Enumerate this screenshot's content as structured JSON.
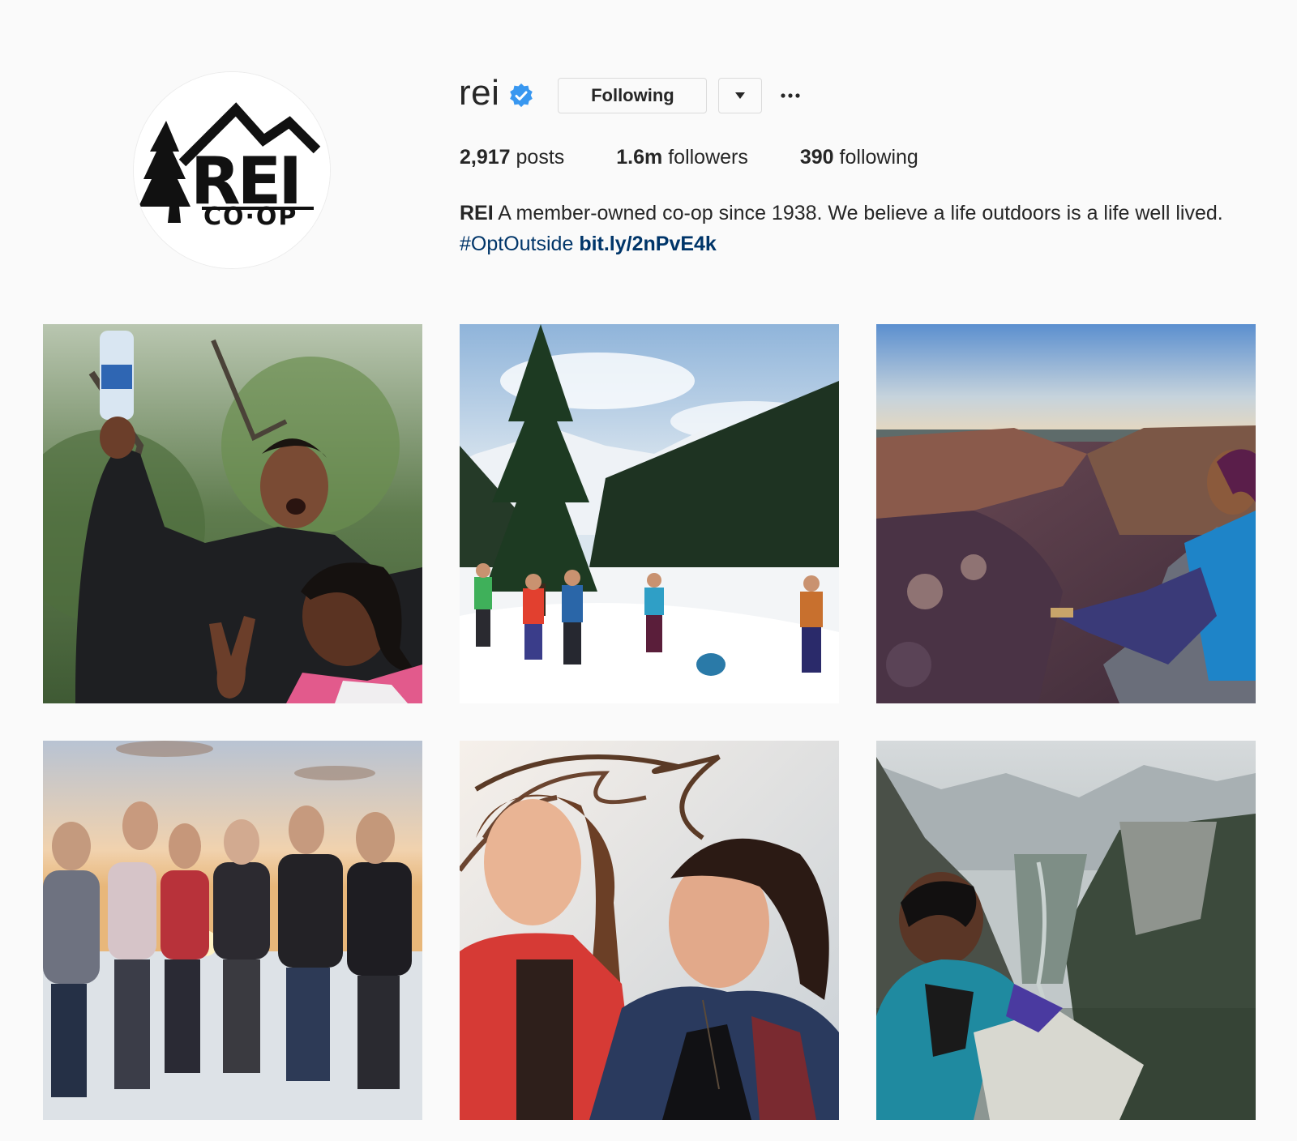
{
  "profile": {
    "username": "rei",
    "verified": true,
    "avatar_icon": "rei-coop-logo",
    "follow_button_label": "Following",
    "dropdown_icon": "triangle-down-icon",
    "more_label": "…"
  },
  "stats": {
    "posts_count": "2,917",
    "posts_label": "posts",
    "followers_count": "1.6m",
    "followers_label": "followers",
    "following_count": "390",
    "following_label": "following"
  },
  "bio": {
    "name": "REI",
    "text": "A member-owned co-op since 1938. We believe a life outdoors is a life well lived.",
    "hashtag": "#OptOutside",
    "link": "bit.ly/2nPvE4k"
  },
  "colors": {
    "background": "#fafafa",
    "text": "#262626",
    "link": "#003569",
    "verified": "#3897f0",
    "border": "#dbdbdb"
  },
  "posts": [
    {
      "thumbnail": "woman-and-girl-forest-photo"
    },
    {
      "thumbnail": "snowshoe-group-mountains-photo"
    },
    {
      "thumbnail": "woman-canyon-sunset-photo"
    },
    {
      "thumbnail": "women-group-snow-sunset-photo"
    },
    {
      "thumbnail": "two-women-windblown-hair-photo"
    },
    {
      "thumbnail": "person-valley-overlook-photo"
    }
  ]
}
